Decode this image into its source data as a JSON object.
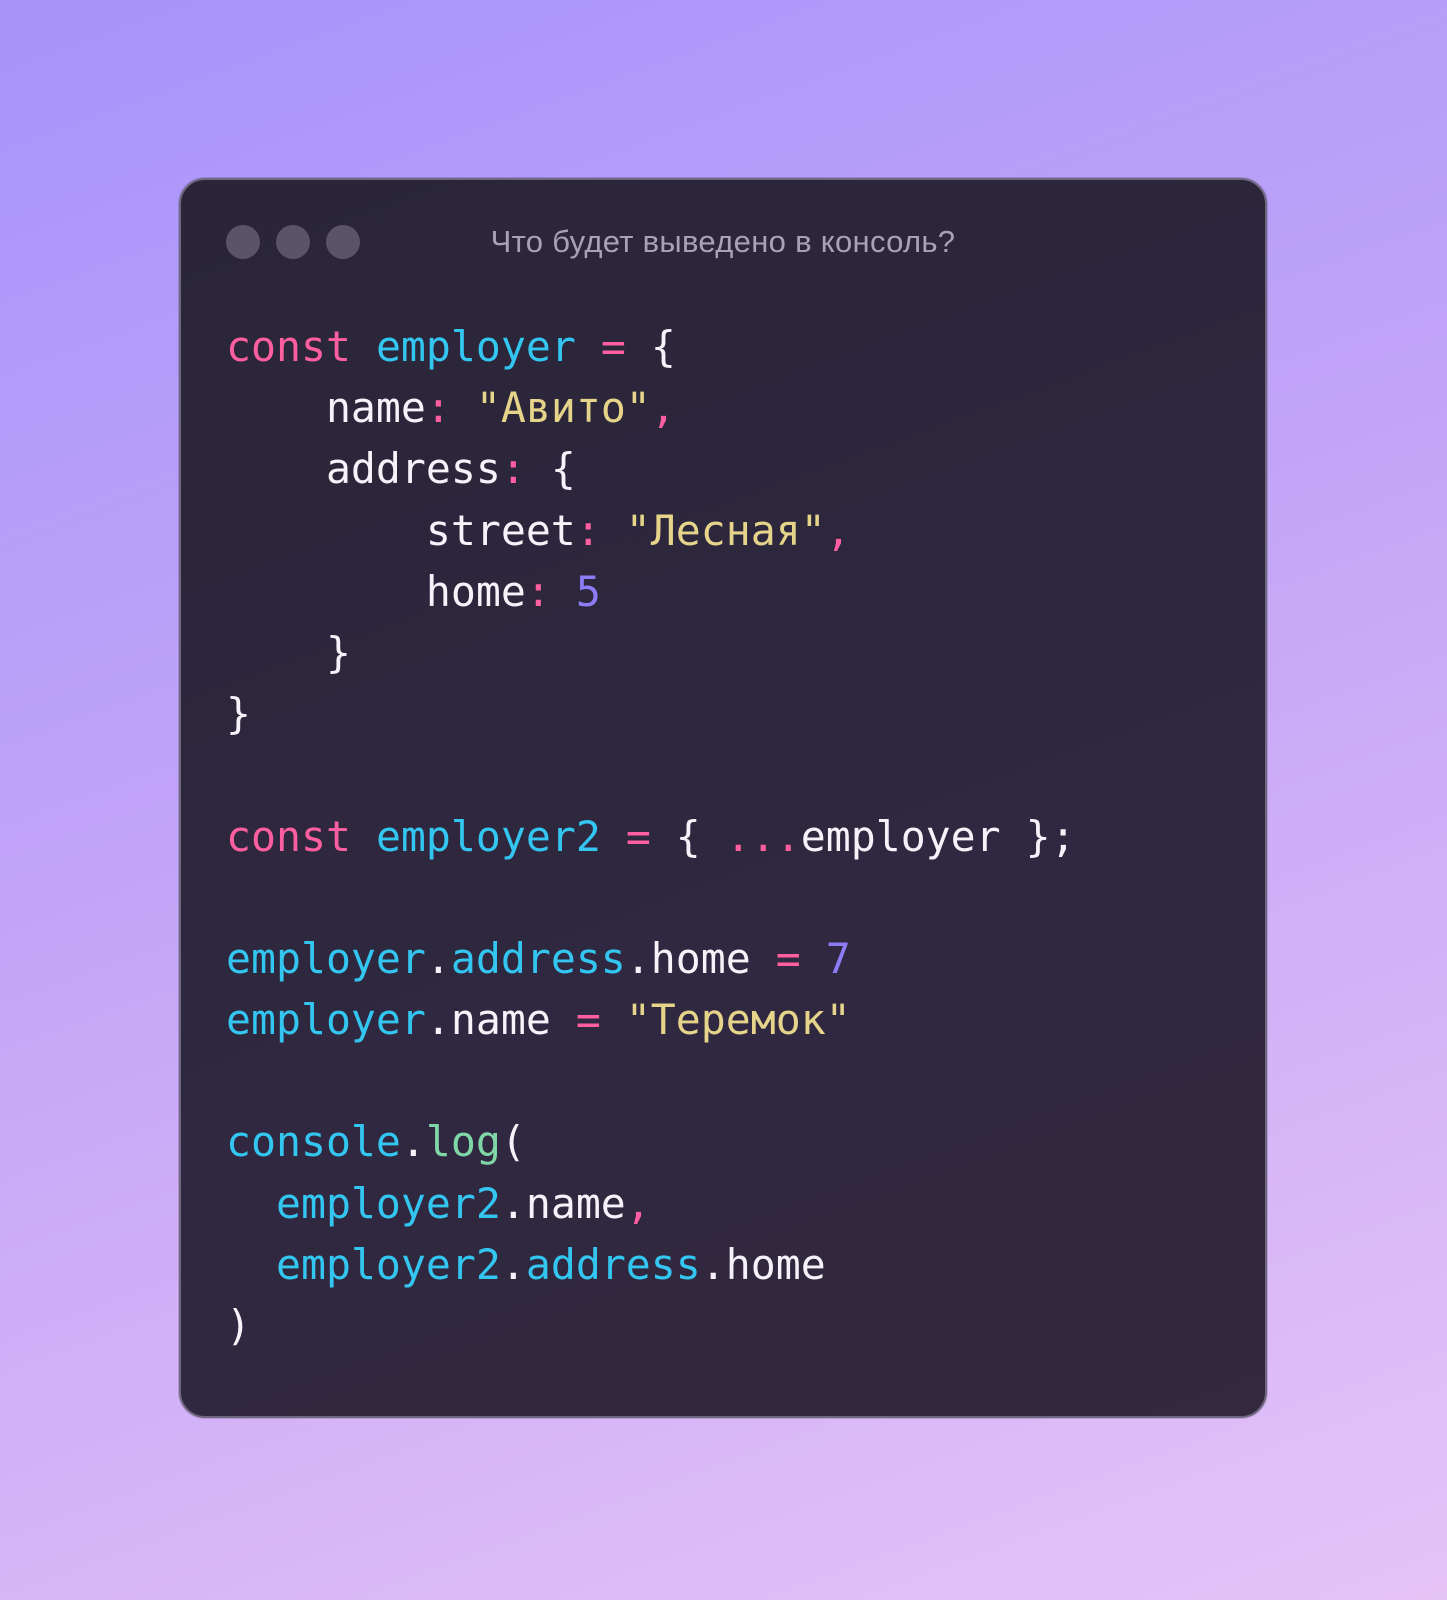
{
  "window": {
    "title": "Что будет выведено в консоль?"
  },
  "code": {
    "lines": [
      [
        {
          "t": "const",
          "c": "kw"
        },
        {
          "t": " ",
          "c": "plain"
        },
        {
          "t": "employer",
          "c": "id"
        },
        {
          "t": " ",
          "c": "plain"
        },
        {
          "t": "=",
          "c": "op"
        },
        {
          "t": " {",
          "c": "plain"
        }
      ],
      [
        {
          "t": "    name",
          "c": "plain"
        },
        {
          "t": ":",
          "c": "op"
        },
        {
          "t": " ",
          "c": "plain"
        },
        {
          "t": "\"Авито\"",
          "c": "str"
        },
        {
          "t": ",",
          "c": "op"
        }
      ],
      [
        {
          "t": "    address",
          "c": "plain"
        },
        {
          "t": ":",
          "c": "op"
        },
        {
          "t": " {",
          "c": "plain"
        }
      ],
      [
        {
          "t": "        street",
          "c": "plain"
        },
        {
          "t": ":",
          "c": "op"
        },
        {
          "t": " ",
          "c": "plain"
        },
        {
          "t": "\"Лесная\"",
          "c": "str"
        },
        {
          "t": ",",
          "c": "op"
        }
      ],
      [
        {
          "t": "        home",
          "c": "plain"
        },
        {
          "t": ":",
          "c": "op"
        },
        {
          "t": " ",
          "c": "plain"
        },
        {
          "t": "5",
          "c": "num"
        }
      ],
      [
        {
          "t": "    }",
          "c": "plain"
        }
      ],
      [
        {
          "t": "}",
          "c": "plain"
        }
      ],
      [],
      [
        {
          "t": "const",
          "c": "kw"
        },
        {
          "t": " ",
          "c": "plain"
        },
        {
          "t": "employer2",
          "c": "id"
        },
        {
          "t": " ",
          "c": "plain"
        },
        {
          "t": "=",
          "c": "op"
        },
        {
          "t": " { ",
          "c": "plain"
        },
        {
          "t": "...",
          "c": "op"
        },
        {
          "t": "employer }",
          "c": "plain"
        },
        {
          "t": ";",
          "c": "plain"
        }
      ],
      [],
      [
        {
          "t": "employer",
          "c": "id"
        },
        {
          "t": ".",
          "c": "plain"
        },
        {
          "t": "address",
          "c": "id"
        },
        {
          "t": ".home ",
          "c": "plain"
        },
        {
          "t": "=",
          "c": "op"
        },
        {
          "t": " ",
          "c": "plain"
        },
        {
          "t": "7",
          "c": "num"
        }
      ],
      [
        {
          "t": "employer",
          "c": "id"
        },
        {
          "t": ".name ",
          "c": "plain"
        },
        {
          "t": "=",
          "c": "op"
        },
        {
          "t": " ",
          "c": "plain"
        },
        {
          "t": "\"Теремок\"",
          "c": "str"
        }
      ],
      [],
      [
        {
          "t": "console",
          "c": "id"
        },
        {
          "t": ".",
          "c": "plain"
        },
        {
          "t": "log",
          "c": "fn"
        },
        {
          "t": "(",
          "c": "plain"
        }
      ],
      [
        {
          "t": "  ",
          "c": "plain"
        },
        {
          "t": "employer2",
          "c": "id"
        },
        {
          "t": ".name",
          "c": "plain"
        },
        {
          "t": ",",
          "c": "op"
        }
      ],
      [
        {
          "t": "  ",
          "c": "plain"
        },
        {
          "t": "employer2",
          "c": "id"
        },
        {
          "t": ".",
          "c": "plain"
        },
        {
          "t": "address",
          "c": "id"
        },
        {
          "t": ".home",
          "c": "plain"
        }
      ],
      [
        {
          "t": ")",
          "c": "plain"
        }
      ]
    ]
  },
  "colors": {
    "keyword": "#ff5fa0",
    "identifier": "#33c6f0",
    "string": "#e6d48a",
    "number": "#8c7cf5",
    "function": "#7fd6a6",
    "text": "#f5f2fa",
    "window_bg": "#2a2538",
    "traffic_dot": "#5b5468"
  }
}
